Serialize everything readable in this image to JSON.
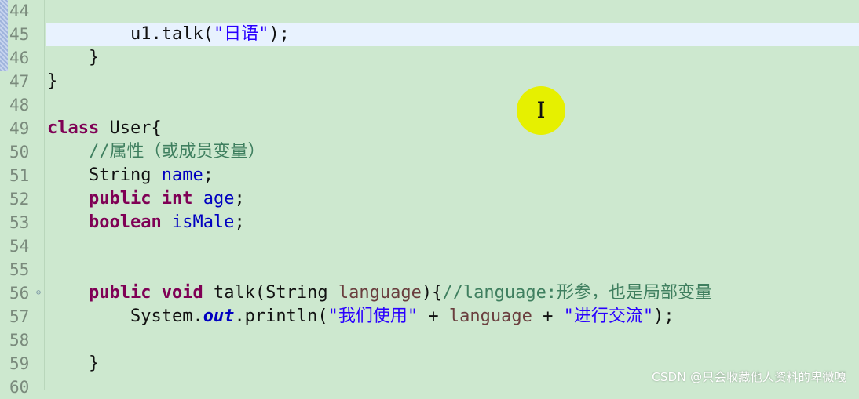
{
  "editor": {
    "current_line": "45",
    "lines": [
      {
        "num": "44",
        "indent": "",
        "tokens": []
      },
      {
        "num": "45",
        "indent": "        ",
        "tokens": [
          {
            "t": "u1.talk(",
            "c": ""
          },
          {
            "t": "\"日语\"",
            "c": "str"
          },
          {
            "t": ");",
            "c": ""
          }
        ]
      },
      {
        "num": "46",
        "indent": "    ",
        "tokens": [
          {
            "t": "}",
            "c": ""
          }
        ]
      },
      {
        "num": "47",
        "indent": "",
        "tokens": [
          {
            "t": "}",
            "c": ""
          }
        ]
      },
      {
        "num": "48",
        "indent": "",
        "tokens": []
      },
      {
        "num": "49",
        "indent": "",
        "tokens": [
          {
            "t": "class",
            "c": "kw"
          },
          {
            "t": " User{",
            "c": ""
          }
        ]
      },
      {
        "num": "50",
        "indent": "    ",
        "tokens": [
          {
            "t": "//属性（或成员变量）",
            "c": "comment"
          }
        ]
      },
      {
        "num": "51",
        "indent": "    ",
        "tokens": [
          {
            "t": "String ",
            "c": ""
          },
          {
            "t": "name",
            "c": "field"
          },
          {
            "t": ";",
            "c": ""
          }
        ]
      },
      {
        "num": "52",
        "indent": "    ",
        "tokens": [
          {
            "t": "public",
            "c": "kw"
          },
          {
            "t": " ",
            "c": ""
          },
          {
            "t": "int",
            "c": "kw"
          },
          {
            "t": " ",
            "c": ""
          },
          {
            "t": "age",
            "c": "field"
          },
          {
            "t": ";",
            "c": ""
          }
        ]
      },
      {
        "num": "53",
        "indent": "    ",
        "tokens": [
          {
            "t": "boolean",
            "c": "kw"
          },
          {
            "t": " ",
            "c": ""
          },
          {
            "t": "isMale",
            "c": "field"
          },
          {
            "t": ";",
            "c": ""
          }
        ]
      },
      {
        "num": "54",
        "indent": "",
        "tokens": []
      },
      {
        "num": "55",
        "indent": "",
        "tokens": []
      },
      {
        "num": "56",
        "indent": "    ",
        "fold": "⊖",
        "tokens": [
          {
            "t": "public",
            "c": "kw"
          },
          {
            "t": " ",
            "c": ""
          },
          {
            "t": "void",
            "c": "kw"
          },
          {
            "t": " talk(String ",
            "c": ""
          },
          {
            "t": "language",
            "c": "param"
          },
          {
            "t": "){",
            "c": ""
          },
          {
            "t": "//language:形参，也是局部变量",
            "c": "comment"
          }
        ]
      },
      {
        "num": "57",
        "indent": "        ",
        "tokens": [
          {
            "t": "System.",
            "c": ""
          },
          {
            "t": "out",
            "c": "static-field"
          },
          {
            "t": ".println(",
            "c": ""
          },
          {
            "t": "\"我们使用\"",
            "c": "str"
          },
          {
            "t": " + ",
            "c": ""
          },
          {
            "t": "language",
            "c": "param"
          },
          {
            "t": " + ",
            "c": ""
          },
          {
            "t": "\"进行交流\"",
            "c": "str"
          },
          {
            "t": ");",
            "c": ""
          }
        ]
      },
      {
        "num": "58",
        "indent": "",
        "tokens": []
      },
      {
        "num": "59",
        "indent": "    ",
        "tokens": [
          {
            "t": "}",
            "c": ""
          }
        ]
      },
      {
        "num": "60",
        "indent": "",
        "tokens": []
      }
    ]
  },
  "cursor": {
    "glyph": "I",
    "icon": "ibeam-cursor-icon",
    "highlight_color": "#e6f000"
  },
  "watermark": {
    "text": "CSDN @只会收藏他人资料的卑微嘎"
  },
  "colors": {
    "background": "#cde8cf",
    "current_line": "#e8f2fe",
    "keyword": "#7f0055",
    "field": "#0000c0",
    "string": "#2a00ff",
    "comment": "#3f7f5f",
    "parameter": "#6a3e3e",
    "line_number": "#7a8a7c"
  }
}
